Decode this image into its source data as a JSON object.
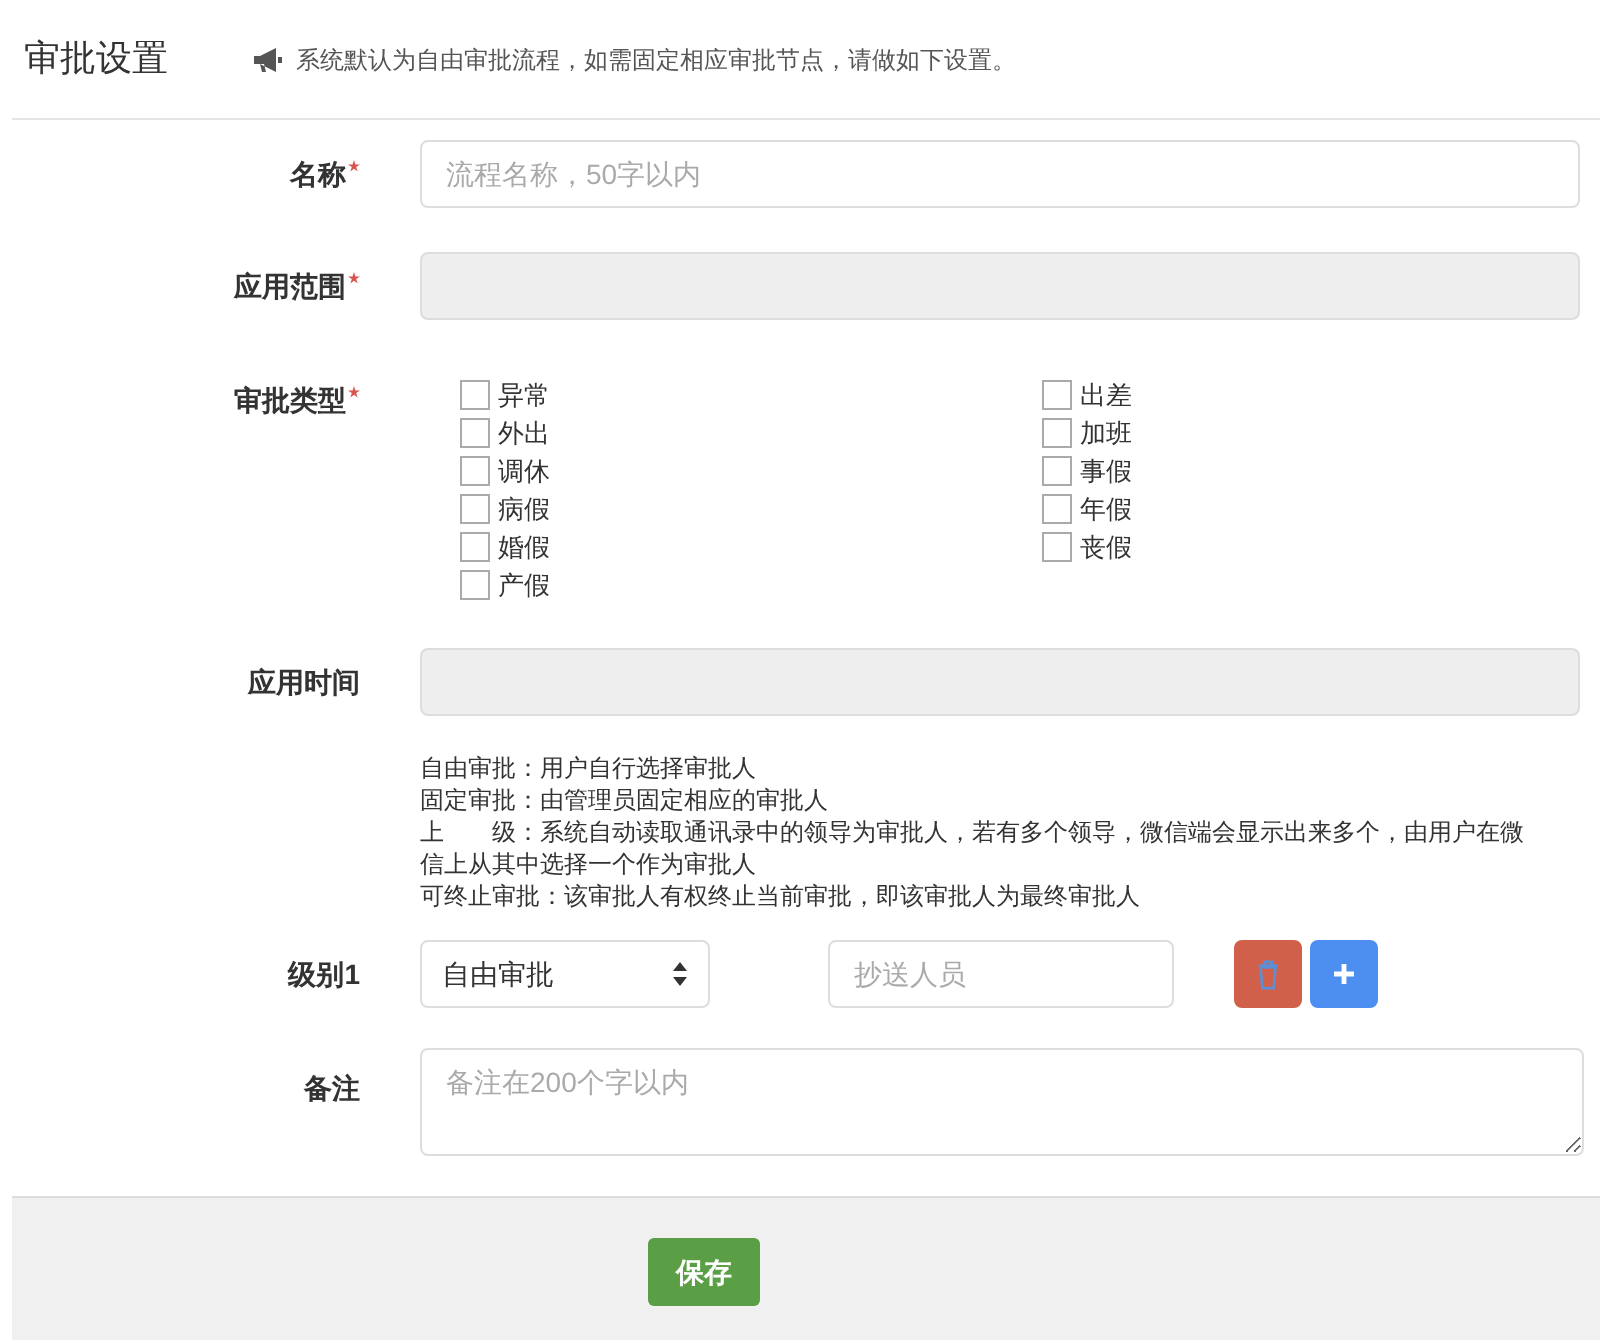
{
  "header": {
    "title": "审批设置",
    "notice": "系统默认为自由审批流程，如需固定相应审批节点，请做如下设置。"
  },
  "fields": [
    {
      "kind": "input",
      "label": "名称",
      "required": true,
      "placeholder": "流程名称，50字以内",
      "disabled": false
    },
    {
      "kind": "input",
      "label": "应用范围",
      "required": true,
      "disabled": true
    },
    {
      "kind": "checkboxes",
      "label": "审批类型",
      "required": true,
      "options": [
        {
          "label": "异常",
          "checked": false
        },
        {
          "label": "外出",
          "checked": false
        },
        {
          "label": "调休",
          "checked": false
        },
        {
          "label": "病假",
          "checked": false
        },
        {
          "label": "婚假",
          "checked": false
        },
        {
          "label": "产假",
          "checked": false
        },
        {
          "label": "出差",
          "checked": false
        },
        {
          "label": "加班",
          "checked": false
        },
        {
          "label": "事假",
          "checked": false
        },
        {
          "label": "年假",
          "checked": false
        },
        {
          "label": "丧假",
          "checked": false
        }
      ]
    },
    {
      "kind": "input",
      "label": "应用时间",
      "required": false,
      "disabled": true
    },
    {
      "kind": "help",
      "lines": [
        "自由审批：用户自行选择审批人",
        "固定审批：由管理员固定相应的审批人",
        "上　　级：系统自动读取通讯录中的领导为审批人，若有多个领导，微信端会显示出来多个，由用户在微信上从其中选择一个作为审批人",
        "可终止审批：该审批人有权终止当前审批，即该审批人为最终审批人"
      ]
    },
    {
      "kind": "level",
      "label": "级别1",
      "required": false,
      "select": "自由审批",
      "cc_placeholder": "抄送人员"
    },
    {
      "kind": "textarea",
      "label": "备注",
      "required": false,
      "placeholder": "备注在200个字以内"
    }
  ],
  "save_button": "保存"
}
